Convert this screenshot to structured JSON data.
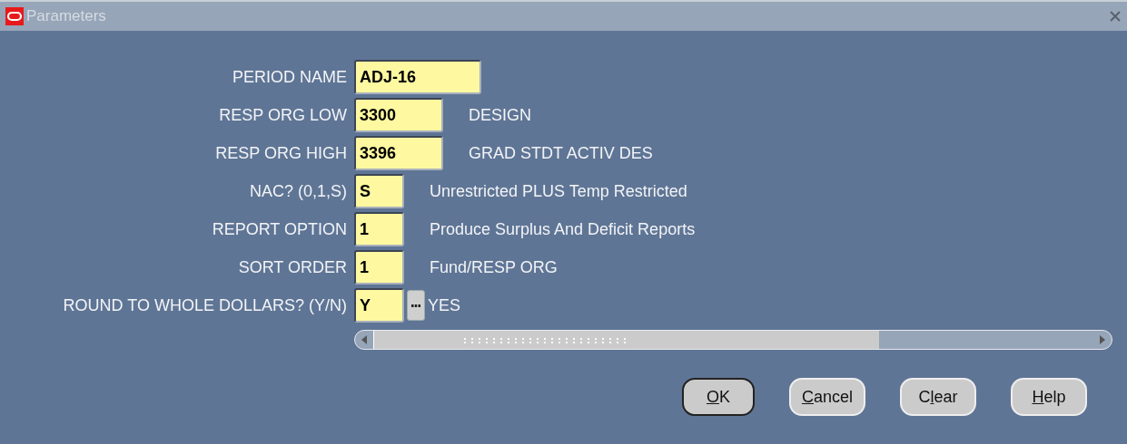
{
  "window": {
    "title": "Parameters"
  },
  "fields": [
    {
      "label": "PERIOD NAME",
      "value": "ADJ-16",
      "kind": "long"
    },
    {
      "label": "RESP ORG LOW",
      "value": "3300",
      "kind": "medium",
      "description": "DESIGN"
    },
    {
      "label": "RESP ORG HIGH",
      "value": "3396",
      "kind": "medium",
      "description": "GRAD STDT ACTIV DES"
    },
    {
      "label": "NAC? (0,1,S)",
      "value": "S",
      "kind": "short",
      "description": "Unrestricted PLUS Temp Restricted"
    },
    {
      "label": "REPORT OPTION",
      "value": "1",
      "kind": "short",
      "description": "Produce Surplus And Deficit Reports"
    },
    {
      "label": "SORT ORDER",
      "value": "1",
      "kind": "short",
      "description": "Fund/RESP ORG"
    },
    {
      "label": "ROUND TO WHOLE DOLLARS? (Y/N)",
      "value": "Y",
      "kind": "short",
      "lov": true,
      "description": "YES"
    }
  ],
  "buttons": [
    {
      "label": [
        {
          "text": "O",
          "underlined": true
        },
        {
          "text": "K",
          "underlined": false
        }
      ],
      "default": true
    },
    {
      "label": [
        {
          "text": "C",
          "underlined": true
        },
        {
          "text": "ancel",
          "underlined": false
        }
      ],
      "default": false
    },
    {
      "label": [
        {
          "text": "C",
          "underlined": false
        },
        {
          "text": "l",
          "underlined": true
        },
        {
          "text": "ear",
          "underlined": false
        }
      ],
      "default": false
    },
    {
      "label": [
        {
          "text": "H",
          "underlined": true
        },
        {
          "text": "elp",
          "underlined": false
        }
      ],
      "default": false
    }
  ]
}
